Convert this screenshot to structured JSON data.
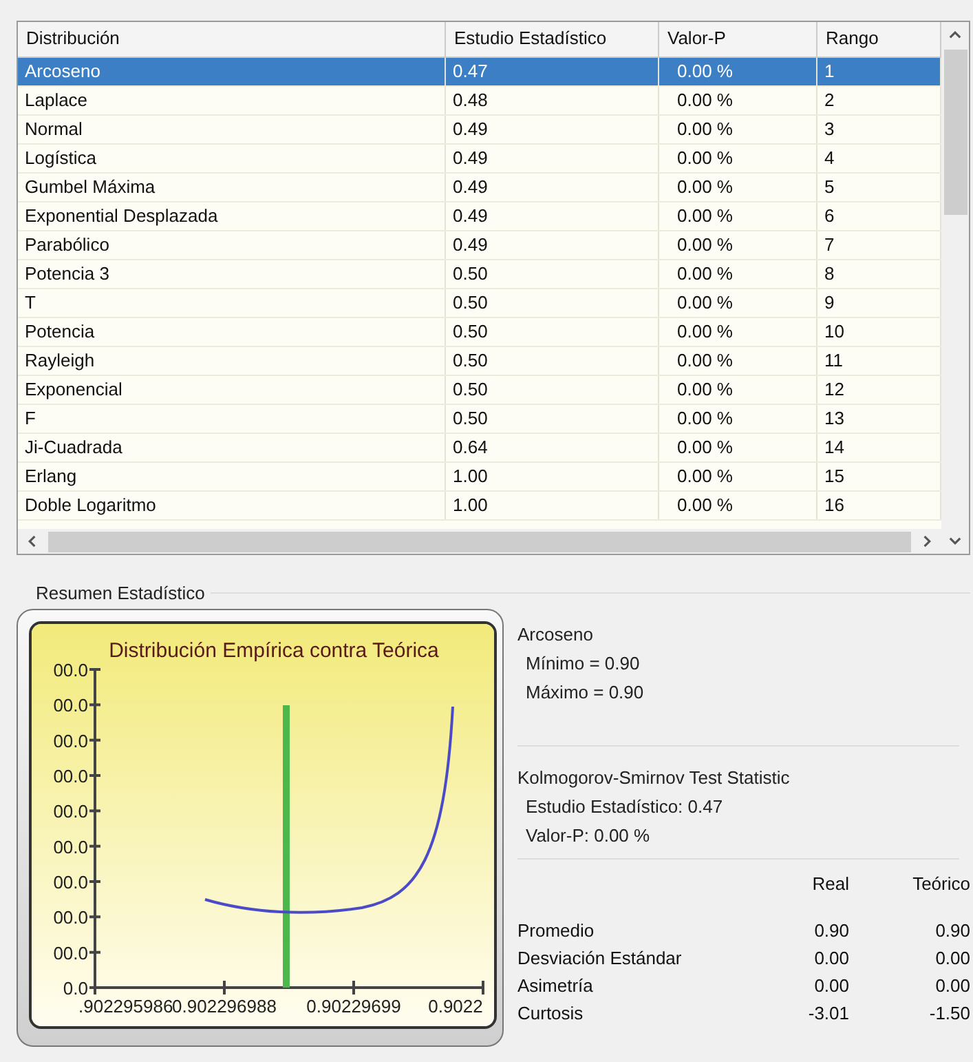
{
  "table": {
    "columns": [
      "Distribución",
      "Estudio Estadístico",
      "Valor-P",
      "Rango"
    ],
    "rows": [
      {
        "cells": [
          "Arcoseno",
          "0.47",
          "0.00 %",
          "1"
        ],
        "selected": true
      },
      {
        "cells": [
          "Laplace",
          "0.48",
          "0.00 %",
          "2"
        ],
        "selected": false
      },
      {
        "cells": [
          "Normal",
          "0.49",
          "0.00 %",
          "3"
        ],
        "selected": false
      },
      {
        "cells": [
          "Logística",
          "0.49",
          "0.00 %",
          "4"
        ],
        "selected": false
      },
      {
        "cells": [
          "Gumbel Máxima",
          "0.49",
          "0.00 %",
          "5"
        ],
        "selected": false
      },
      {
        "cells": [
          "Exponential Desplazada",
          "0.49",
          "0.00 %",
          "6"
        ],
        "selected": false
      },
      {
        "cells": [
          "Parabólico",
          "0.49",
          "0.00 %",
          "7"
        ],
        "selected": false
      },
      {
        "cells": [
          "Potencia 3",
          "0.50",
          "0.00 %",
          "8"
        ],
        "selected": false
      },
      {
        "cells": [
          "T",
          "0.50",
          "0.00 %",
          "9"
        ],
        "selected": false
      },
      {
        "cells": [
          "Potencia",
          "0.50",
          "0.00 %",
          "10"
        ],
        "selected": false
      },
      {
        "cells": [
          "Rayleigh",
          "0.50",
          "0.00 %",
          "11"
        ],
        "selected": false
      },
      {
        "cells": [
          "Exponencial",
          "0.50",
          "0.00 %",
          "12"
        ],
        "selected": false
      },
      {
        "cells": [
          "F",
          "0.50",
          "0.00 %",
          "13"
        ],
        "selected": false
      },
      {
        "cells": [
          "Ji-Cuadrada",
          "0.64",
          "0.00 %",
          "14"
        ],
        "selected": false
      },
      {
        "cells": [
          "Erlang",
          "1.00",
          "0.00 %",
          "15"
        ],
        "selected": false
      },
      {
        "cells": [
          "Doble Logaritmo",
          "1.00",
          "0.00 %",
          "16"
        ],
        "selected": false
      }
    ]
  },
  "summary": {
    "title": "Resumen Estadístico",
    "chart": {
      "title": "Distribución Empírica contra Teórica",
      "y_labels": [
        "00.0",
        "00.0",
        "00.0",
        "00.0",
        "00.0",
        "00.0",
        "00.0",
        "00.0",
        "00.0",
        "0.0"
      ],
      "x_labels": [
        ".902295986",
        "0.902296988",
        "0.90229699",
        "0.9022"
      ]
    },
    "distribution": "Arcoseno",
    "minimum": "Mínimo = 0.90",
    "maximum": "Máximo = 0.90",
    "test_title": "Kolmogorov-Smirnov Test Statistic",
    "statistic": "Estudio Estadístico: 0.47",
    "p_value": "Valor-P: 0.00 %",
    "columns": [
      "Real",
      "Teórico"
    ],
    "rows": [
      {
        "label": "Promedio",
        "real": "0.90",
        "theoretical": "0.90"
      },
      {
        "label": "Desviación Estándar",
        "real": "0.00",
        "theoretical": "0.00"
      },
      {
        "label": "Asimetría",
        "real": "0.00",
        "theoretical": "0.00"
      },
      {
        "label": "Curtosis",
        "real": "-3.01",
        "theoretical": "-1.50"
      }
    ]
  }
}
